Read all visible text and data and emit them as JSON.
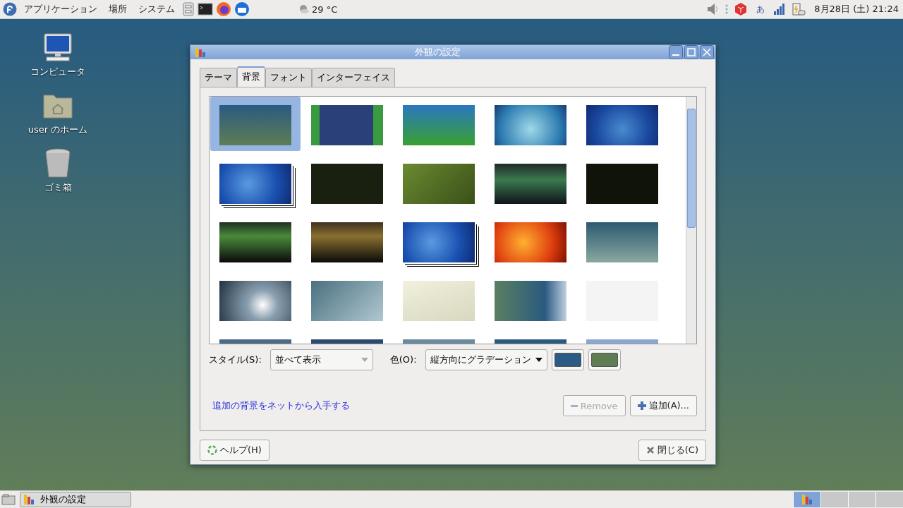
{
  "top_panel": {
    "menus": [
      "アプリケーション",
      "場所",
      "システム"
    ],
    "weather": "29 °C",
    "clock": "8月28日 (土) 21:24",
    "input_method": "あ"
  },
  "desktop_icons": [
    {
      "kind": "computer",
      "label": "コンピュータ"
    },
    {
      "kind": "home",
      "label": "user のホーム"
    },
    {
      "kind": "trash",
      "label": "ゴミ箱"
    }
  ],
  "window": {
    "title": "外観の設定",
    "tabs": [
      {
        "label": "テーマ",
        "selected": false
      },
      {
        "label": "背景",
        "selected": true
      },
      {
        "label": "フォント",
        "selected": false
      },
      {
        "label": "インターフェイス",
        "selected": false
      }
    ],
    "thumbnails": [
      {
        "selected": true,
        "stacked": false
      },
      {
        "selected": false,
        "stacked": false
      },
      {
        "selected": false,
        "stacked": false
      },
      {
        "selected": false,
        "stacked": false
      },
      {
        "selected": false,
        "stacked": false
      },
      {
        "selected": false,
        "stacked": true
      },
      {
        "selected": false,
        "stacked": false
      },
      {
        "selected": false,
        "stacked": false
      },
      {
        "selected": false,
        "stacked": false
      },
      {
        "selected": false,
        "stacked": false
      },
      {
        "selected": false,
        "stacked": false
      },
      {
        "selected": false,
        "stacked": false
      },
      {
        "selected": false,
        "stacked": true
      },
      {
        "selected": false,
        "stacked": false
      },
      {
        "selected": false,
        "stacked": false
      },
      {
        "selected": false,
        "stacked": false
      },
      {
        "selected": false,
        "stacked": false
      },
      {
        "selected": false,
        "stacked": false
      },
      {
        "selected": false,
        "stacked": false
      },
      {
        "selected": false,
        "stacked": false
      },
      {
        "selected": false,
        "stacked": false
      },
      {
        "selected": false,
        "stacked": false
      },
      {
        "selected": false,
        "stacked": false
      },
      {
        "selected": false,
        "stacked": false
      },
      {
        "selected": false,
        "stacked": false
      }
    ],
    "style_label": "スタイル(S):",
    "style_value": "並べて表示",
    "color_label": "色(O):",
    "color_value": "縦方向にグラデーション",
    "colors": [
      {
        "color": "#2b5a85"
      },
      {
        "color": "#5f7d55"
      }
    ],
    "link": "追加の背景をネットから入手する",
    "remove_button": {
      "label": "Remove",
      "disabled": true
    },
    "add_button": "追加(A)...",
    "help_button": "ヘルプ(H)",
    "close_button": "閉じる(C)"
  },
  "taskbar": {
    "window_button": "外観の設定",
    "workspaces": [
      {
        "selected": true
      },
      {
        "selected": false
      },
      {
        "selected": false
      },
      {
        "selected": false
      }
    ]
  }
}
